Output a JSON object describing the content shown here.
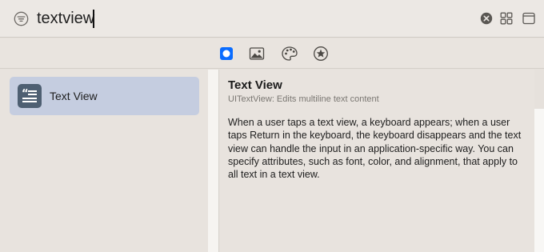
{
  "search": {
    "value": "textview",
    "placeholder": ""
  },
  "toolbar": {
    "buttons": [
      {
        "icon": "views-icon",
        "selected": true
      },
      {
        "icon": "image-icon",
        "selected": false
      },
      {
        "icon": "palette-icon",
        "selected": false
      },
      {
        "icon": "star-icon",
        "selected": false
      }
    ]
  },
  "results": [
    {
      "label": "Text View",
      "icon": "text-view-icon",
      "selected": true
    }
  ],
  "detail": {
    "title": "Text View",
    "subtitle": "UITextView: Edits multiline text content",
    "body": "When a user taps a text view, a keyboard appears; when a user taps Return in the keyboard, the keyboard disappears and the text view can handle the input in an application-specific way. You can specify attributes, such as font, color, and alignment, that apply to all text in a text view."
  },
  "colors": {
    "accent": "#0a6cff",
    "selection": "#c5cde0",
    "icon_tile": "#4e5f72"
  }
}
